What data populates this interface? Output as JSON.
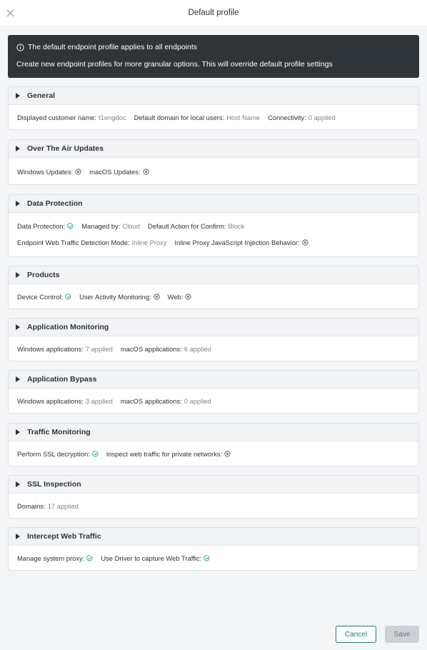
{
  "header": {
    "title": "Default profile"
  },
  "banner": {
    "line1": "The default endpoint profile applies to all endpoints",
    "line2": "Create new endpoint profiles for more granular options. This will override default profile settings"
  },
  "colors": {
    "enabled": "#2aa38f",
    "disabled": "#3a3f44",
    "primary": "#1e7f73"
  },
  "sections": {
    "general": {
      "title": "General",
      "rows": [
        [
          {
            "label": "Displayed customer name:",
            "value": "f1engdoc"
          },
          {
            "label": "Default domain for local users:",
            "value": "Host Name"
          },
          {
            "label": "Connectivity:",
            "value": "0 applied"
          }
        ]
      ]
    },
    "ota": {
      "title": "Over The Air Updates",
      "rows": [
        [
          {
            "label": "Windows Updates:",
            "icon": "disabled-x-icon"
          },
          {
            "label": "macOS Updates:",
            "icon": "disabled-x-icon"
          }
        ]
      ]
    },
    "data_protection": {
      "title": "Data Protection",
      "rows": [
        [
          {
            "label": "Data Protection:",
            "icon": "enabled-check-icon"
          },
          {
            "label": "Managed by:",
            "value": "Cloud"
          },
          {
            "label": "Default Action for Confirm:",
            "value": "Block"
          }
        ],
        [
          {
            "label": "Endpoint Web Traffic Detection Mode:",
            "value": "Inline Proxy"
          },
          {
            "label": "Inline Proxy JavaScript Injection Behavior:",
            "icon": "disabled-x-icon"
          }
        ]
      ]
    },
    "products": {
      "title": "Products",
      "rows": [
        [
          {
            "label": "Device Control:",
            "icon": "enabled-check-icon"
          },
          {
            "label": "User Activity Monitoring:",
            "icon": "disabled-x-icon"
          },
          {
            "label": "Web:",
            "icon": "disabled-x-icon"
          }
        ]
      ]
    },
    "app_monitoring": {
      "title": "Application Monitoring",
      "rows": [
        [
          {
            "label": "Windows applications:",
            "value": "7 applied"
          },
          {
            "label": "macOS applications:",
            "value": "6 applied"
          }
        ]
      ]
    },
    "app_bypass": {
      "title": "Application Bypass",
      "rows": [
        [
          {
            "label": "Windows applications:",
            "value": "3 applied"
          },
          {
            "label": "macOS applications:",
            "value": "0 applied"
          }
        ]
      ]
    },
    "traffic_monitoring": {
      "title": "Traffic Monitoring",
      "rows": [
        [
          {
            "label": "Perform SSL decryption:",
            "icon": "enabled-check-icon"
          },
          {
            "label": "Inspect web traffic for private networks:",
            "icon": "disabled-x-icon"
          }
        ]
      ]
    },
    "ssl_inspection": {
      "title": "SSL Inspection",
      "rows": [
        [
          {
            "label": "Domains:",
            "value": "17 applied"
          }
        ]
      ]
    },
    "intercept_web": {
      "title": "Intercept Web Traffic",
      "rows": [
        [
          {
            "label": "Manage system proxy:",
            "icon": "enabled-check-icon"
          },
          {
            "label": "Use Driver to capture Web Traffic:",
            "icon": "enabled-check-icon"
          }
        ]
      ]
    }
  },
  "footer": {
    "cancel_label": "Cancel",
    "save_label": "Save"
  }
}
